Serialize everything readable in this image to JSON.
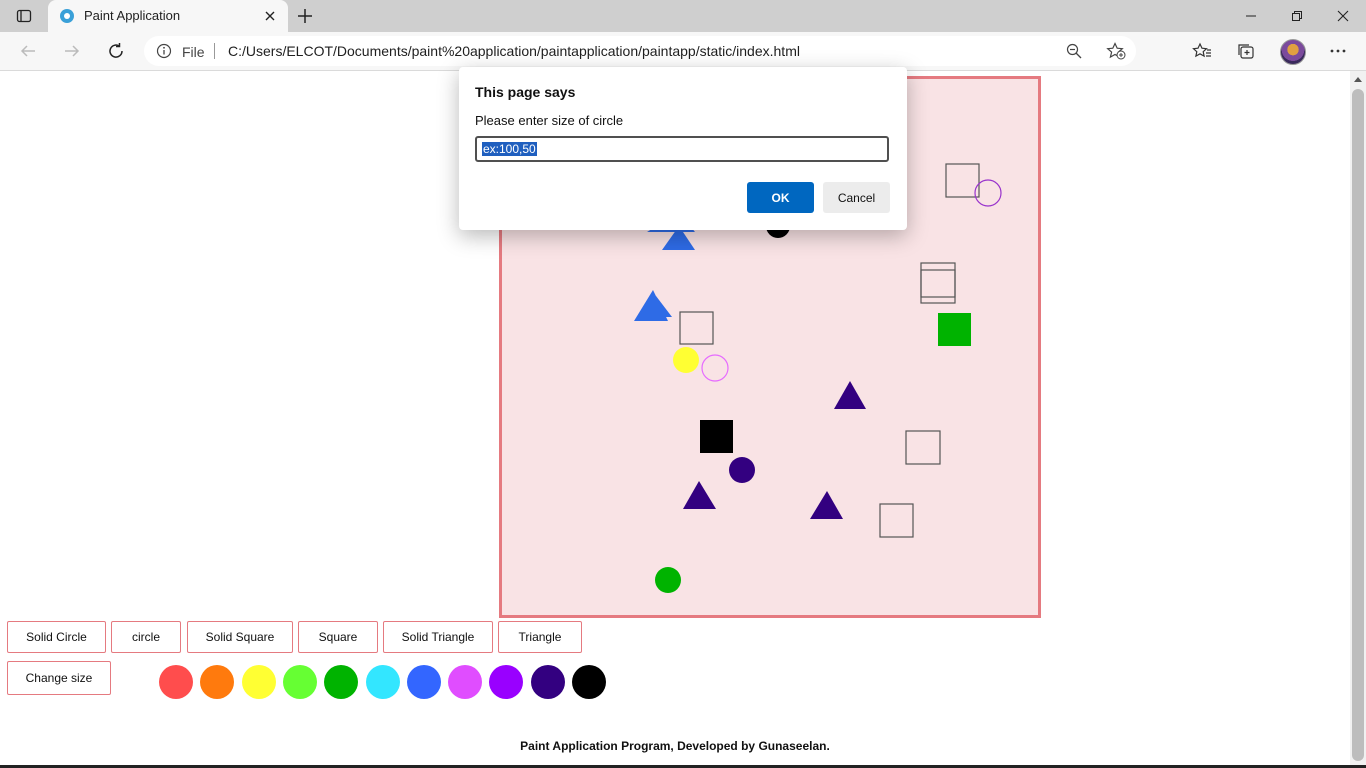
{
  "browser": {
    "tab_title": "Paint Application",
    "address_prefix": "File",
    "url": "C:/Users/ELCOT/Documents/paint%20application/paintapplication/paintapp/static/index.html"
  },
  "toolbar": {
    "buttons": [
      {
        "label": "Solid Circle"
      },
      {
        "label": "circle"
      },
      {
        "label": "Solid Square"
      },
      {
        "label": "Square"
      },
      {
        "label": "Solid Triangle"
      },
      {
        "label": "Triangle"
      },
      {
        "label": "Change size"
      }
    ]
  },
  "palette": {
    "colors": [
      "#ff4d4d",
      "#ff7a0d",
      "#ffff33",
      "#66ff33",
      "#00b300",
      "#33e6ff",
      "#3366ff",
      "#e04dff",
      "#9900ff",
      "#330080",
      "#000000"
    ]
  },
  "canvas": {
    "shape_colors": {
      "blue": "#2e6be6",
      "black": "#000000",
      "green": "#00b300",
      "yellow": "#ffff33",
      "indigo": "#330080",
      "outline_gray": "#555555",
      "outline_purple": "#9933cc",
      "outline_pink": "#e66bff"
    }
  },
  "footer": {
    "text": "Paint Application Program, Developed by Gunaseelan."
  },
  "dialog": {
    "title": "This page says",
    "message": "Please enter size of circle",
    "input_value": "ex:100,50",
    "ok_label": "OK",
    "cancel_label": "Cancel"
  }
}
